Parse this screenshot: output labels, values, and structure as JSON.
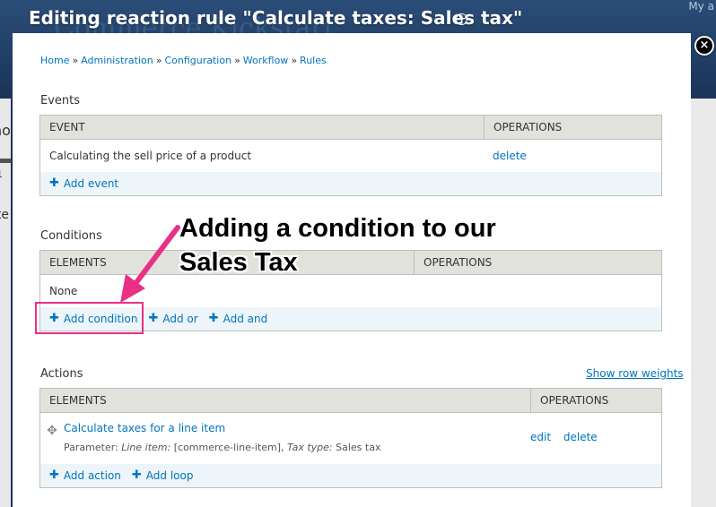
{
  "background": {
    "site_name": "Commerce Kickstart",
    "my_account": "My a",
    "left_text_1": "ho",
    "left_text_2": "1",
    "left_text_3": "ite"
  },
  "overlay": {
    "title": "Editing reaction rule \"Calculate taxes: Sales tax\"",
    "toggle_symbol": "+",
    "close_symbol": "×"
  },
  "breadcrumb": [
    {
      "label": "Home"
    },
    {
      "label": "Administration"
    },
    {
      "label": "Configuration"
    },
    {
      "label": "Workflow"
    },
    {
      "label": "Rules"
    }
  ],
  "breadcrumb_separator": "»",
  "events": {
    "title": "Events",
    "columns": [
      "EVENT",
      "OPERATIONS"
    ],
    "rows": [
      {
        "event": "Calculating the sell price of a product",
        "op": "delete"
      }
    ],
    "add": "Add event"
  },
  "conditions": {
    "title": "Conditions",
    "columns": [
      "ELEMENTS",
      "OPERATIONS"
    ],
    "empty": "None",
    "add_condition": "Add condition",
    "add_or": "Add or",
    "add_and": "Add and"
  },
  "annotation": {
    "line1": "Adding a condition to our",
    "line2": "Sales Tax",
    "color": "#ea2f86"
  },
  "actions": {
    "title": "Actions",
    "show_row_weights": "Show row weights",
    "columns": [
      "ELEMENTS",
      "OPERATIONS"
    ],
    "item_title": "Calculate taxes for a line item",
    "param_prefix": "Parameter:",
    "param_line_item_label": "Line item:",
    "param_line_item_value": "[commerce-line-item],",
    "param_tax_type_label": "Tax type:",
    "param_tax_type_value": "Sales tax",
    "edit": "edit",
    "delete": "delete",
    "add_action": "Add action",
    "add_loop": "Add loop"
  },
  "colors": {
    "link": "#0074bd",
    "header_bg": "#e1e2dc",
    "footer_bg": "#edf5fa",
    "overlay_bg": "#1b3458"
  }
}
